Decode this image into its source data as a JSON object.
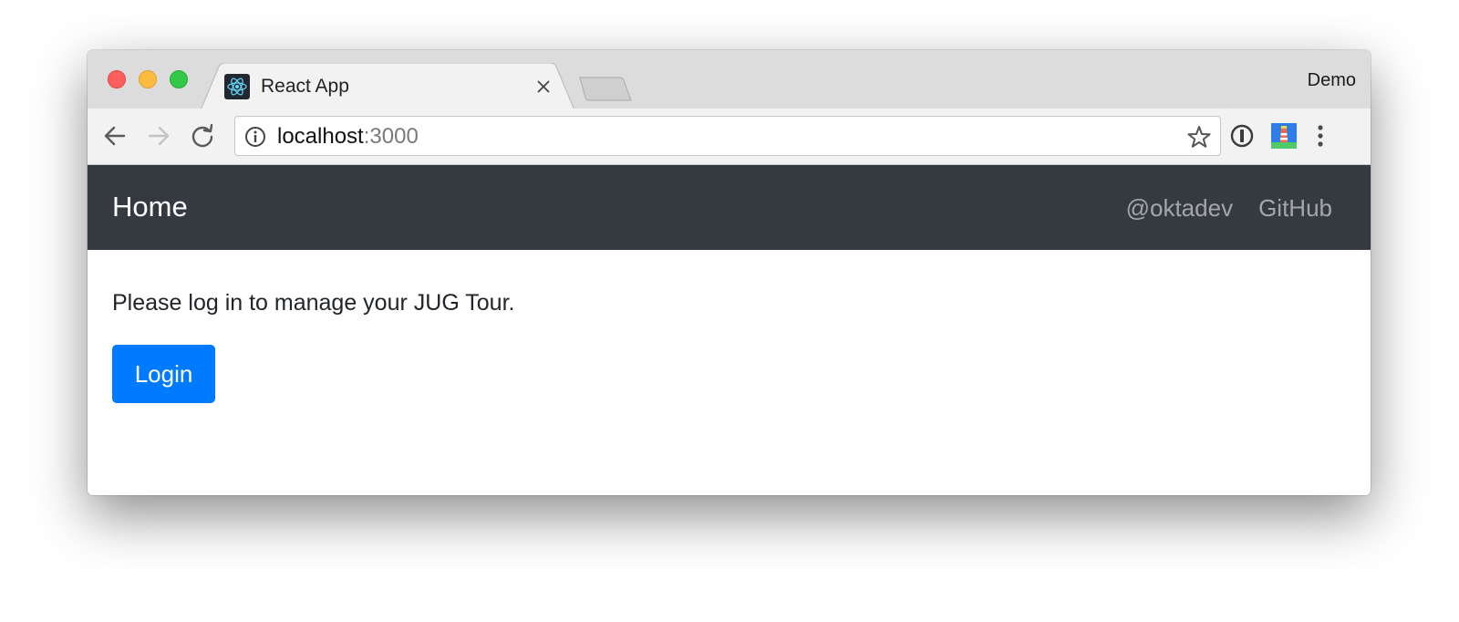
{
  "browser": {
    "profile_name": "Demo",
    "tab": {
      "title": "React App",
      "favicon": "react-logo-icon"
    },
    "address_bar": {
      "host": "localhost",
      "port": ":3000"
    },
    "colors": {
      "close": "#fc605c",
      "minimize": "#fdbc40",
      "maximize": "#34c84a"
    }
  },
  "app": {
    "navbar": {
      "brand": "Home",
      "links": [
        "@oktadev",
        "GitHub"
      ],
      "background": "#343a40"
    },
    "message": "Please log in to manage your JUG Tour.",
    "login_button": {
      "label": "Login",
      "color": "#007bff"
    }
  }
}
